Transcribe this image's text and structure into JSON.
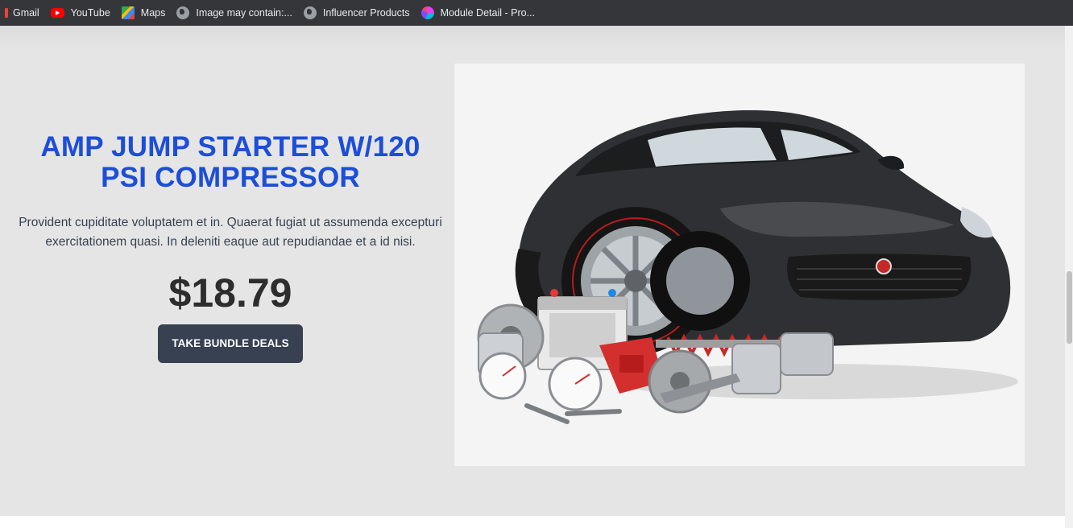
{
  "bookmarks": [
    {
      "label": "Gmail",
      "icon": "gmail-icon"
    },
    {
      "label": "YouTube",
      "icon": "youtube-icon"
    },
    {
      "label": "Maps",
      "icon": "maps-icon"
    },
    {
      "label": "Image may contain:...",
      "icon": "globe-icon"
    },
    {
      "label": "Influencer Products",
      "icon": "globe-icon"
    },
    {
      "label": "Module Detail - Pro...",
      "icon": "module-icon"
    }
  ],
  "hero": {
    "title": "AMP JUMP STARTER W/120 PSI COMPRESSOR",
    "description": "Provident cupiditate voluptatem et in. Quaerat fugiat ut assumenda excepturi exercitationem quasi. In deleniti eaque aut repudiandae et a id nisi.",
    "price": "$18.79",
    "cta_label": "TAKE BUNDLE DEALS"
  },
  "colors": {
    "title": "#1d4ed8",
    "button_bg": "#374151",
    "hero_bg": "#e5e5e5",
    "panel_bg": "#f4f4f4"
  }
}
